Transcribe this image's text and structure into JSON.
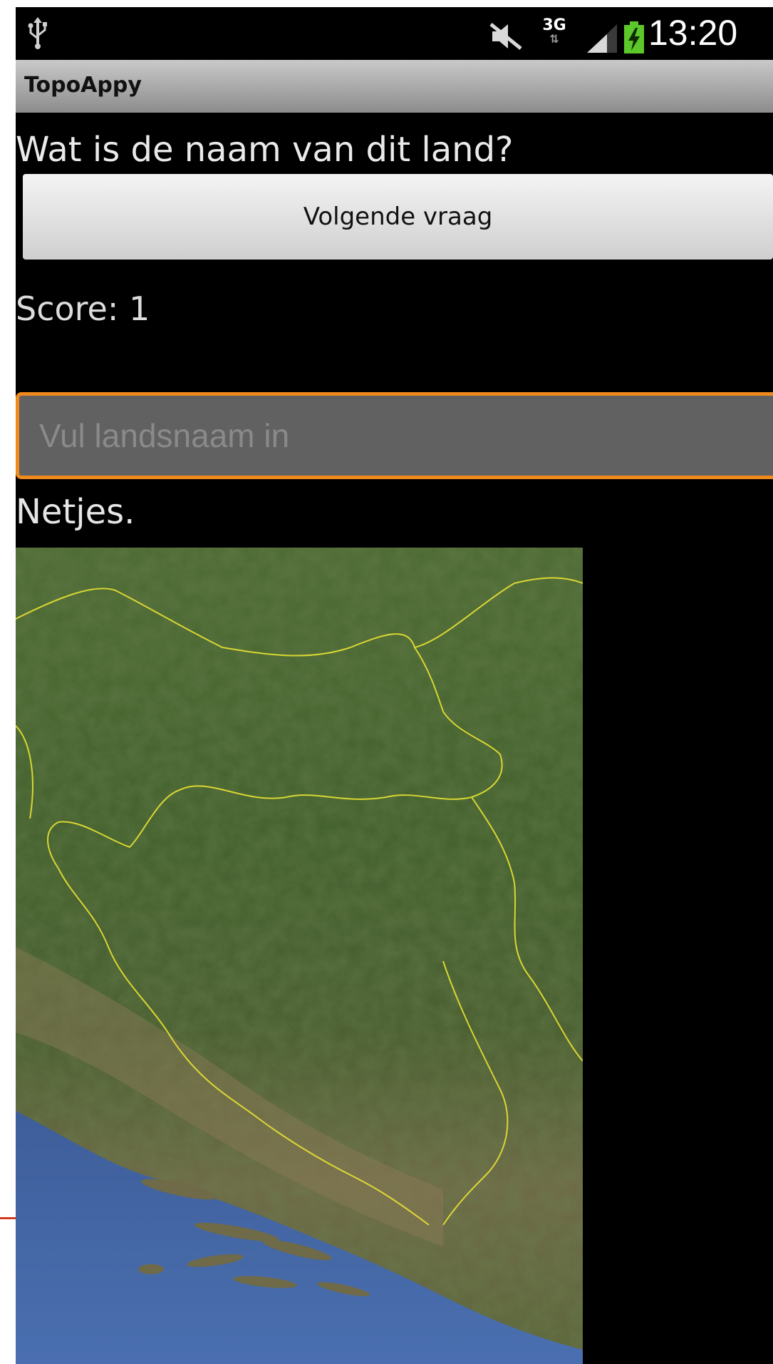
{
  "status_bar": {
    "icons": [
      "usb-icon",
      "mute-icon",
      "network-3g-icon",
      "signal-icon",
      "battery-charging-icon"
    ],
    "network_type": "3G",
    "clock": "13:20"
  },
  "app": {
    "title": "TopoAppy"
  },
  "quiz": {
    "question": "Wat is de naam van dit land?",
    "next_button_label": "Volgende vraag",
    "score_text": "Score: 1",
    "answer_placeholder": "Vul landsnaam in",
    "answer_value": "",
    "feedback_text": "Netjes."
  },
  "colors": {
    "input_focus_border": "#f0891e",
    "background": "#000000",
    "titlebar": "#a9a9a9"
  }
}
